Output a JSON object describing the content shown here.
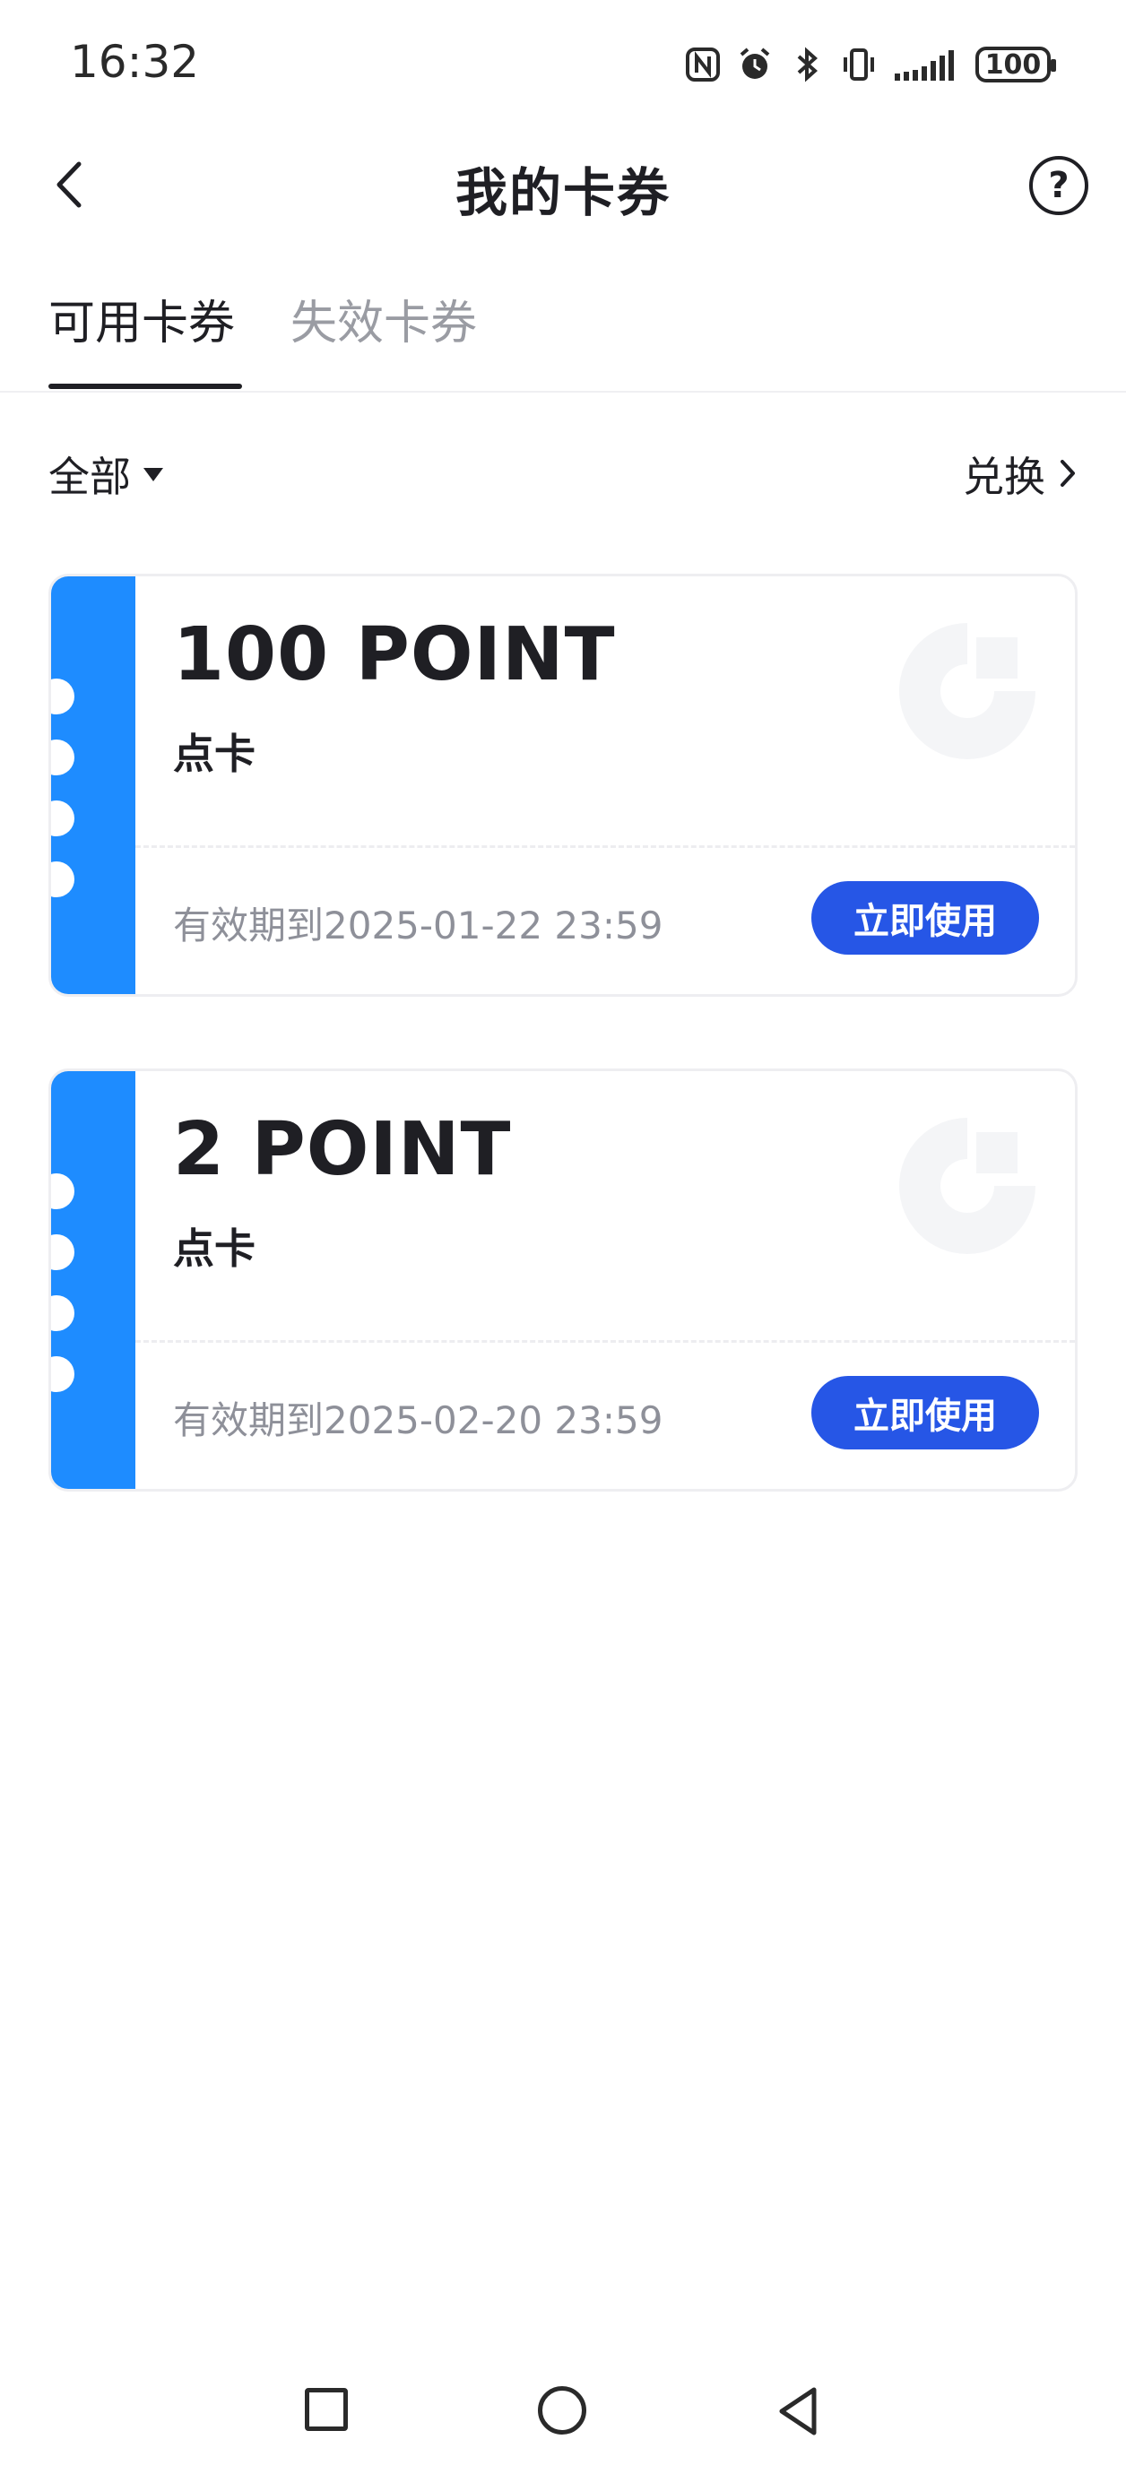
{
  "status_bar": {
    "time": "16:32",
    "battery": "100",
    "icons": [
      "nfc-icon",
      "alarm-icon",
      "bluetooth-icon",
      "vibrate-icon",
      "signal-icon",
      "battery-icon"
    ]
  },
  "header": {
    "title": "我的卡券",
    "back_icon": "chevron-left-icon",
    "help_icon": "question-circle-icon",
    "help_symbol": "?"
  },
  "tabs": [
    {
      "label": "可用卡券",
      "active": true
    },
    {
      "label": "失效卡券",
      "active": false
    }
  ],
  "filter": {
    "label": "全部",
    "exchange_label": "兑换"
  },
  "coupons": [
    {
      "points": "100 POINT",
      "type": "点卡",
      "expiry": "有效期到2025-01-22 23:59",
      "action": "立即使用"
    },
    {
      "points": "2 POINT",
      "type": "点卡",
      "expiry": "有效期到2025-02-20 23:59",
      "action": "立即使用"
    }
  ],
  "colors": {
    "stripe": "#1e8cff",
    "button": "#2656e6",
    "text_primary": "#1f1f24",
    "text_secondary": "#8e9099",
    "tab_inactive": "#9a9ca3"
  },
  "nav_bar": {
    "icons": [
      "recent-apps-icon",
      "home-icon",
      "back-icon"
    ]
  }
}
